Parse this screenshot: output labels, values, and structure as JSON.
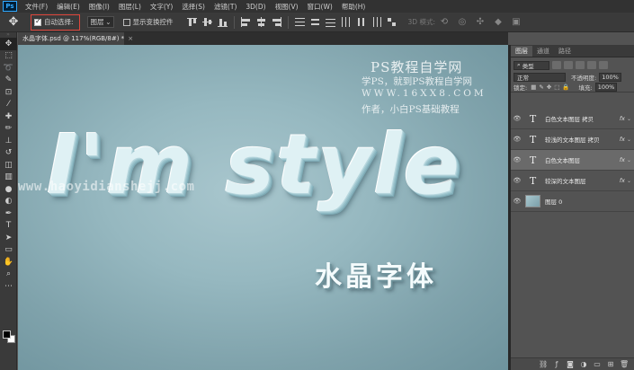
{
  "app": {
    "logo": "Ps"
  },
  "menu": [
    "文件(F)",
    "编辑(E)",
    "图像(I)",
    "图层(L)",
    "文字(Y)",
    "选择(S)",
    "滤镜(T)",
    "3D(D)",
    "视图(V)",
    "窗口(W)",
    "帮助(H)"
  ],
  "options": {
    "auto_select_label": "自动选择:",
    "auto_select_checked": true,
    "layer_select_value": "图层",
    "show_transform_label": "显示变换控件",
    "mode_3d_label": "3D 模式:"
  },
  "document": {
    "tab_title": "水晶字体.psd @ 117%(RGB/8#) *",
    "tab_close": "×"
  },
  "canvas": {
    "wm_title": "PS教程自学网",
    "wm_line1": "学PS，就到PS教程自学网",
    "wm_line2": "WWW.16XX8.COM",
    "wm_line3": "作者，小白PS基础教程",
    "wm_url": "www.haoyidianshejj.com",
    "main_text": "I'm style",
    "sub_text": "水晶字体"
  },
  "panel": {
    "tabs": [
      "图层",
      "通道",
      "路径"
    ],
    "active_tab": 0,
    "filter_label": "类型",
    "blend_mode": "正常",
    "opacity_label": "不透明度:",
    "opacity_value": "100%",
    "lock_label": "锁定:",
    "fill_label": "填充:",
    "fill_value": "100%",
    "layers": [
      {
        "name": "白色文本图层 拷贝",
        "type": "text",
        "fx": "fx",
        "selected": false
      },
      {
        "name": "较浅的文本图层 拷贝",
        "type": "text",
        "fx": "fx",
        "selected": false
      },
      {
        "name": "白色文本图层",
        "type": "text",
        "fx": "fx",
        "selected": true
      },
      {
        "name": "较深的文本图层",
        "type": "text",
        "fx": "fx",
        "selected": false
      },
      {
        "name": "图层 0",
        "type": "image",
        "fx": "",
        "selected": false
      }
    ]
  },
  "colors": {
    "accent_red": "#e0463c",
    "canvas_bg": "#96b8c0",
    "panel_bg": "#535353"
  }
}
